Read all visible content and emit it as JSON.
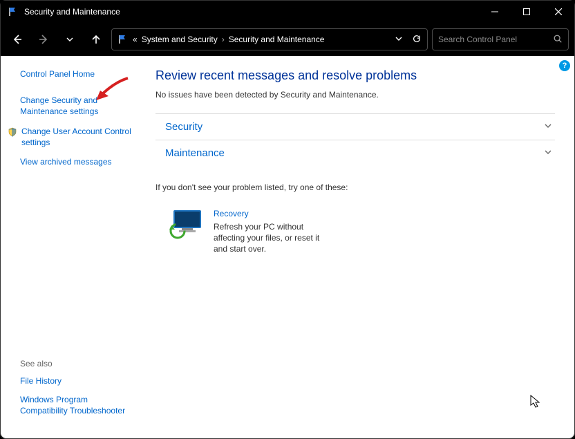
{
  "titlebar": {
    "title": "Security and Maintenance"
  },
  "toolbar": {
    "breadcrumb_prefix": "«",
    "crumb1": "System and Security",
    "crumb2": "Security and Maintenance",
    "search_placeholder": "Search Control Panel"
  },
  "sidebar": {
    "home": "Control Panel Home",
    "link1": "Change Security and Maintenance settings",
    "link2": "Change User Account Control settings",
    "link3": "View archived messages",
    "see_also": "See also",
    "fh": "File History",
    "wp": "Windows Program Compatibility Troubleshooter"
  },
  "main": {
    "title": "Review recent messages and resolve problems",
    "subtitle": "No issues have been detected by Security and Maintenance.",
    "panel_security": "Security",
    "panel_maintenance": "Maintenance",
    "try_text": "If you don't see your problem listed, try one of these:",
    "recovery_title": "Recovery",
    "recovery_desc": "Refresh your PC without affecting your files, or reset it and start over."
  }
}
